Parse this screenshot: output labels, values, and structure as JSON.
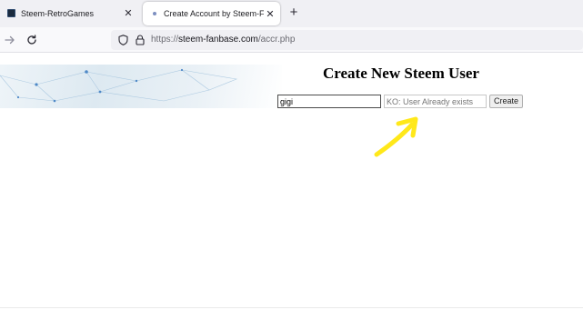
{
  "browser": {
    "tabs": [
      {
        "title": "Steem-RetroGames",
        "close": "✕",
        "active": false
      },
      {
        "title": "Create Account by Steem-Fanba",
        "close": "✕",
        "active": true
      }
    ],
    "new_tab": "+",
    "url": {
      "scheme": "https://",
      "host": "steem-fanbase.com",
      "path": "/accr.php"
    }
  },
  "page": {
    "heading": "Create New Steem User",
    "username_value": "gigi",
    "status_placeholder": "KO: User Already exists",
    "create_label": "Create"
  },
  "colors": {
    "annotation_arrow": "#ffe81a",
    "banner_dots": "#4f89c7"
  }
}
